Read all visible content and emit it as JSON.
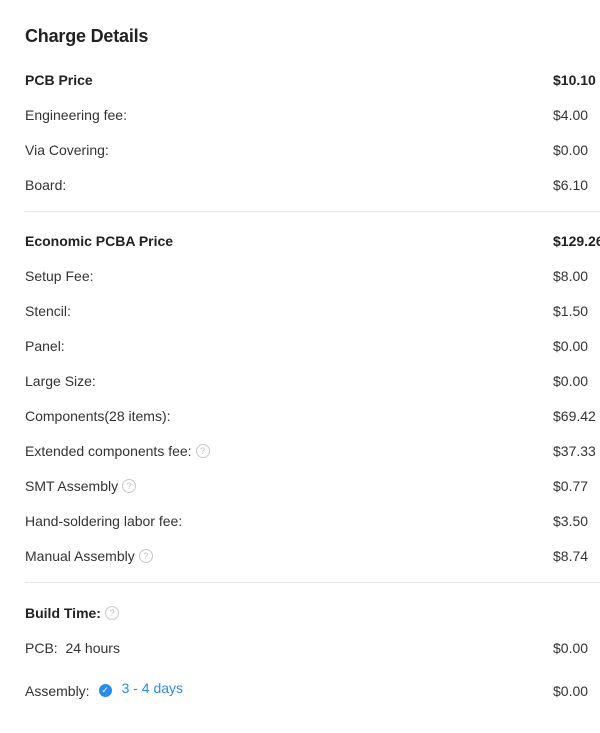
{
  "title": "Charge Details",
  "pcb": {
    "heading": "PCB Price",
    "heading_value": "$10.10",
    "items": [
      {
        "label": "Engineering fee:",
        "value": "$4.00"
      },
      {
        "label": "Via Covering:",
        "value": "$0.00"
      },
      {
        "label": "Board:",
        "value": "$6.10"
      }
    ]
  },
  "pcba": {
    "heading": "Economic PCBA Price",
    "heading_value": "$129.26",
    "items": [
      {
        "label": "Setup Fee:",
        "value": "$8.00"
      },
      {
        "label": "Stencil:",
        "value": "$1.50"
      },
      {
        "label": "Panel:",
        "value": "$0.00"
      },
      {
        "label": "Large Size:",
        "value": "$0.00"
      },
      {
        "label": "Components(28 items):",
        "value": "$69.42"
      },
      {
        "label": "Extended components fee:",
        "value": "$37.33"
      },
      {
        "label": "SMT Assembly",
        "value": "$0.77"
      },
      {
        "label": "Hand-soldering labor fee:",
        "value": "$3.50"
      },
      {
        "label": "Manual Assembly",
        "value": "$8.74"
      }
    ]
  },
  "build_time": {
    "heading": "Build Time:",
    "pcb_label": "PCB:",
    "pcb_time": "24 hours",
    "pcb_value": "$0.00",
    "assembly_label": "Assembly:",
    "assembly_time": "3 - 4 days",
    "assembly_value": "$0.00"
  },
  "icons": {
    "help": "question-circle-icon",
    "check": "check-circle-icon"
  },
  "colors": {
    "accent": "#2a8af0",
    "divider": "#e6e6e6"
  }
}
